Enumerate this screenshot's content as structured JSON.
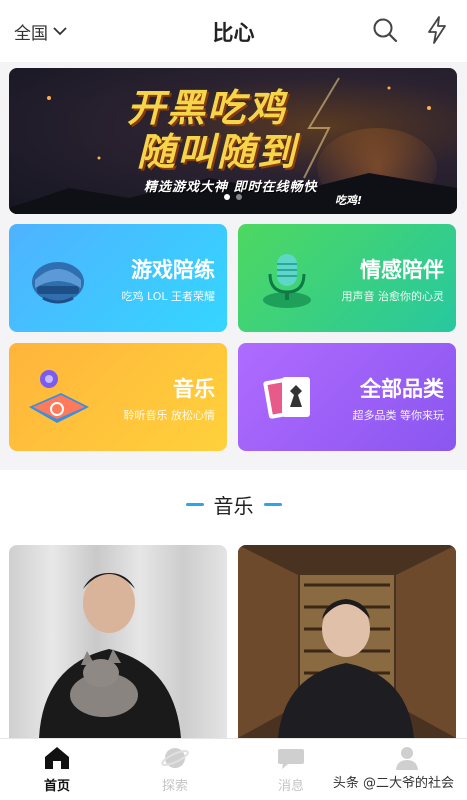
{
  "header": {
    "region_label": "全国",
    "title": "比心"
  },
  "banner": {
    "headline_line1": "开黑吃鸡",
    "headline_line2": "随叫随到",
    "tagline": "精选游戏大神 即时在线畅快",
    "tagline_end": "吃鸡!",
    "slides": 2,
    "active_slide": 0
  },
  "categories": [
    {
      "title": "游戏陪练",
      "subtitle": "吃鸡 LOL 王者荣耀",
      "icon": "helmet-icon"
    },
    {
      "title": "情感陪伴",
      "subtitle": "用声音 治愈你的心灵",
      "icon": "microphone-icon"
    },
    {
      "title": "音乐",
      "subtitle": "聆听音乐 放松心情",
      "icon": "music-stage-icon"
    },
    {
      "title": "全部品类",
      "subtitle": "超多品类 等你来玩",
      "icon": "cards-chess-icon"
    }
  ],
  "section": {
    "title": "音乐"
  },
  "tabs": [
    {
      "label": "首页",
      "icon": "home-icon",
      "active": true
    },
    {
      "label": "探索",
      "icon": "planet-icon",
      "active": false
    },
    {
      "label": "消息",
      "icon": "chat-bubble-icon",
      "active": false
    },
    {
      "label": "我的",
      "icon": "person-icon",
      "active": false
    }
  ],
  "watermark": "头条 @二大爷的社会",
  "colors": {
    "accent": "#2aa6e8",
    "card_game": "#4fb2ff",
    "card_emotion": "#4ed860",
    "card_music": "#ffc13b",
    "card_all": "#a062f8"
  }
}
